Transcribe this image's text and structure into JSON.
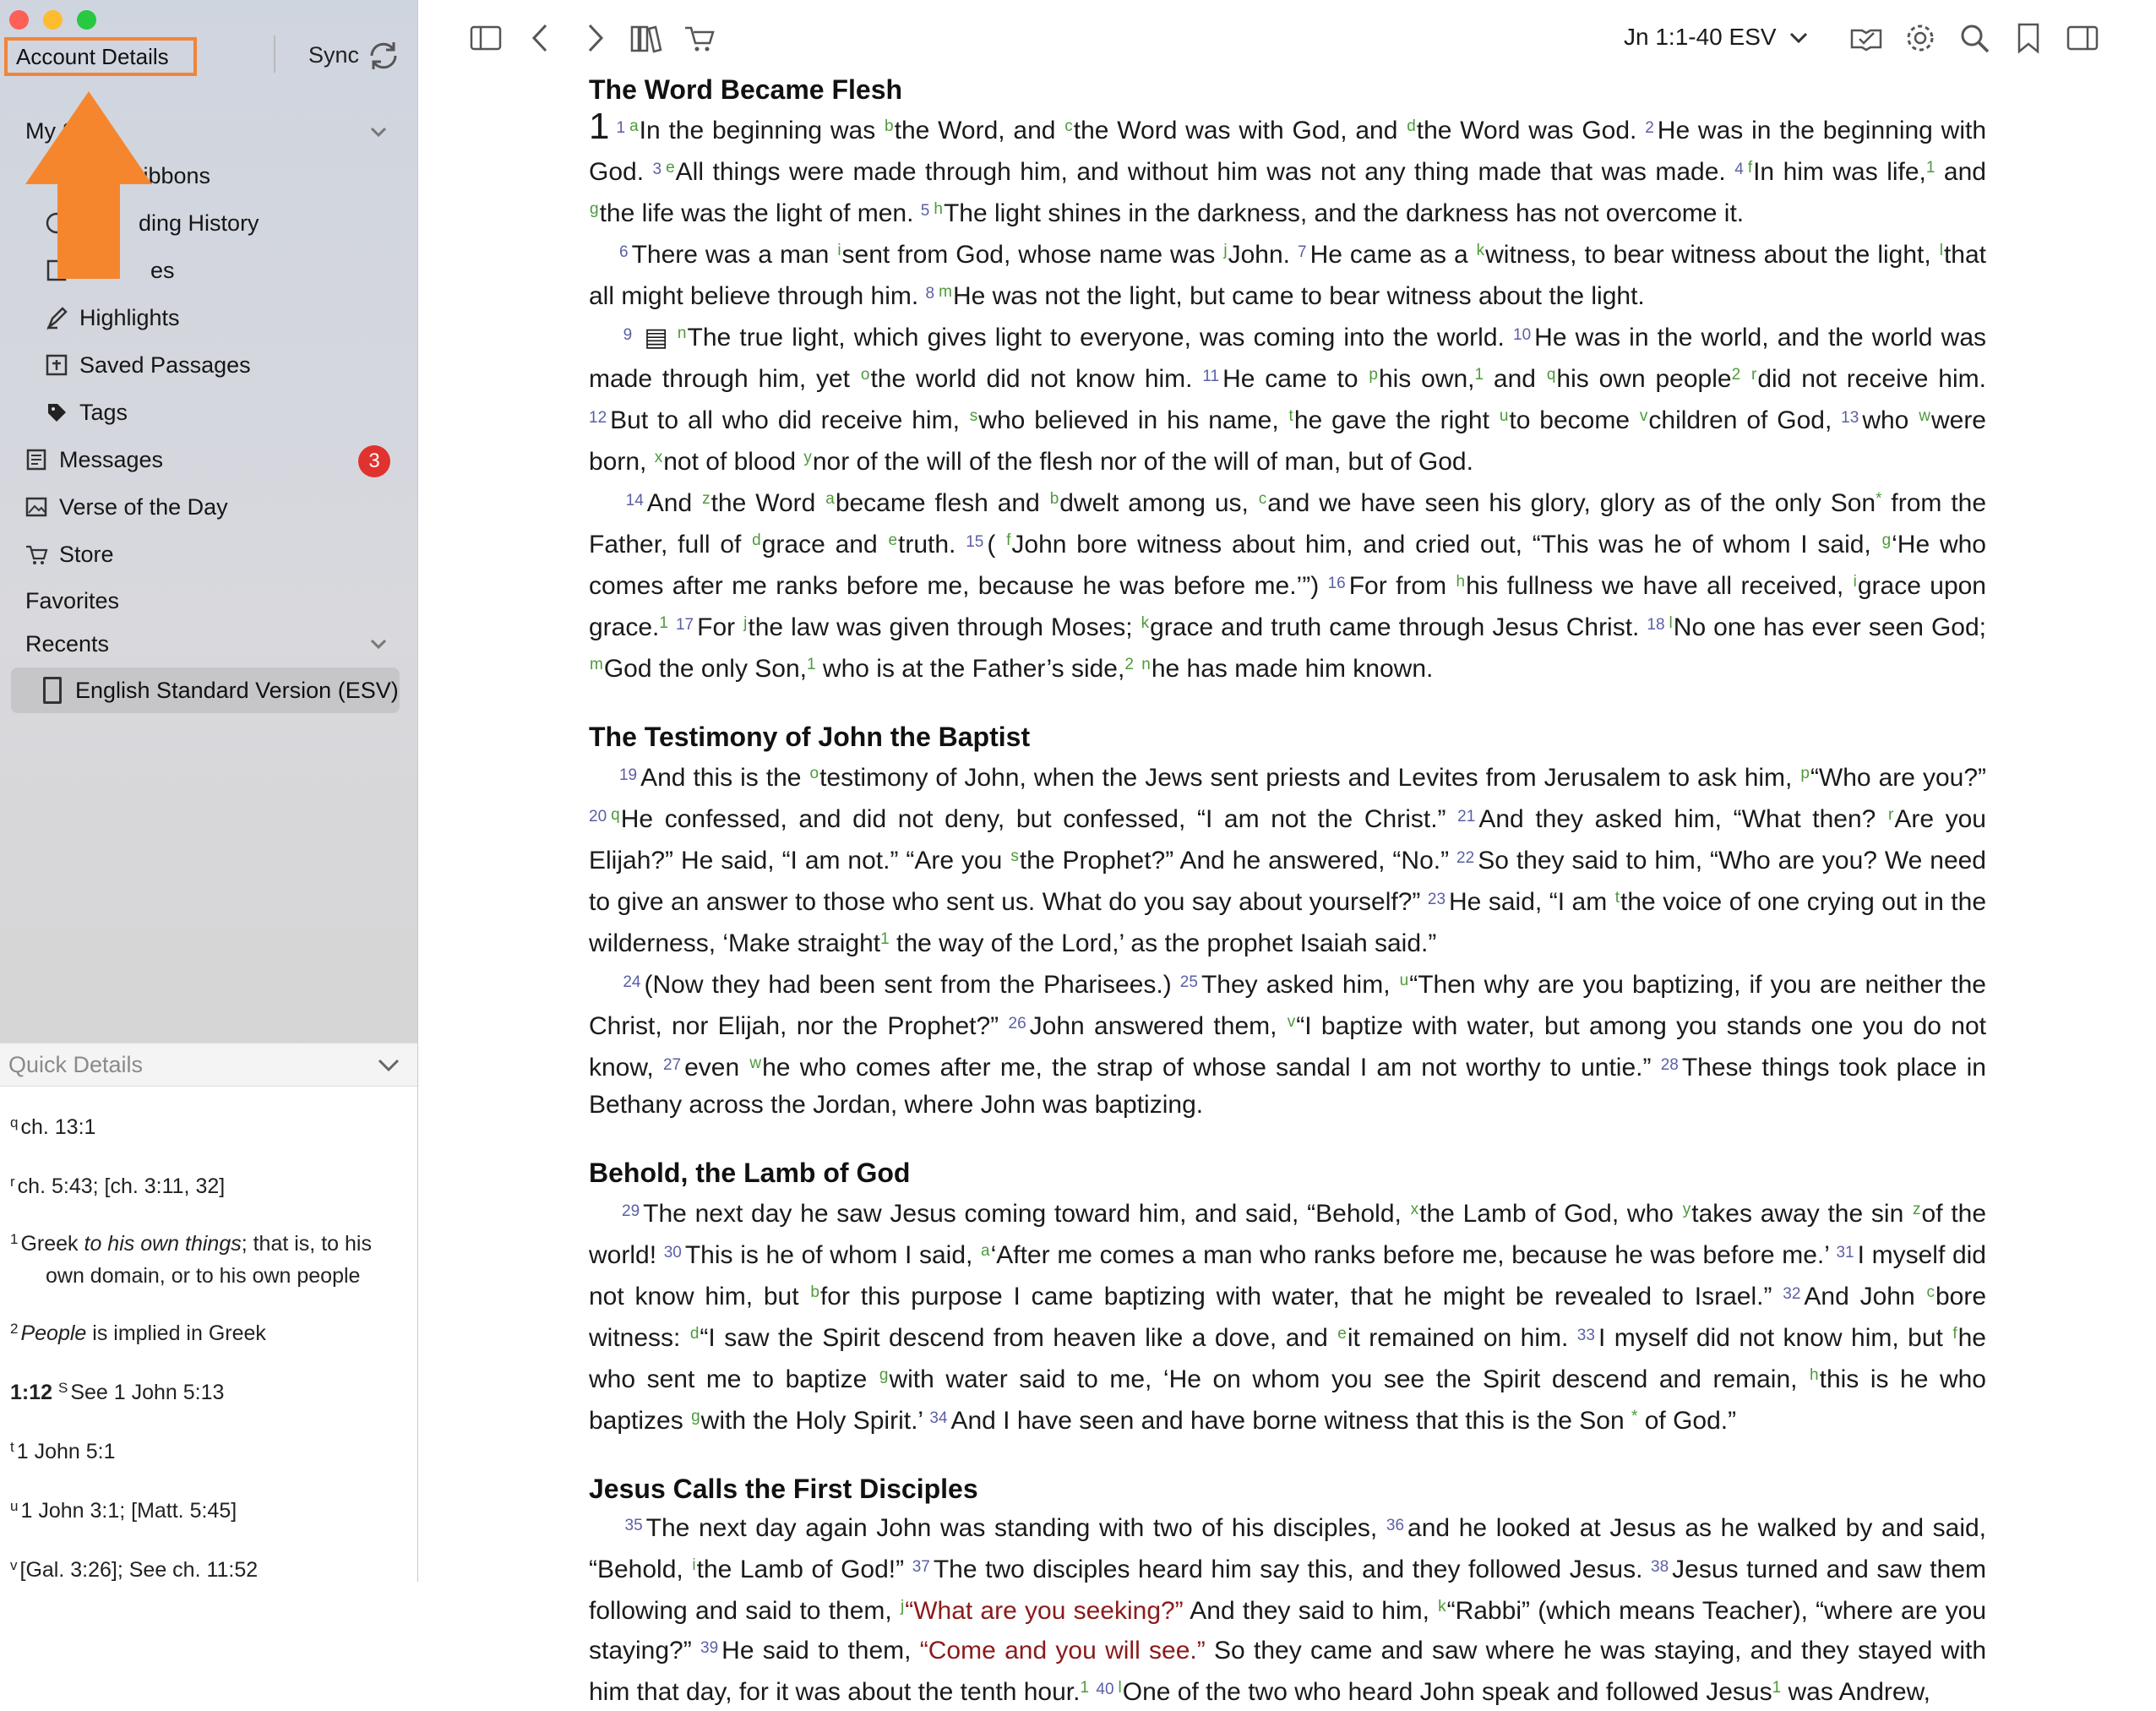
{
  "window": {
    "traffic_lights": [
      "#fe5f57",
      "#febc2e",
      "#28c840"
    ]
  },
  "sidebar": {
    "account_details": "Account Details",
    "sync_label": "Sync",
    "sections": {
      "my_stuff": "My S",
      "ribbons": "Ribbons",
      "reading_history": "ding History",
      "notes": "es",
      "highlights": "Highlights",
      "saved_passages": "Saved Passages",
      "tags": "Tags",
      "messages": "Messages",
      "messages_badge": "3",
      "verse_of_the_day": "Verse of the Day",
      "store": "Store",
      "favorites": "Favorites",
      "recents": "Recents",
      "recent_item": "English Standard Version (ESV)"
    }
  },
  "quick_details": {
    "title": "Quick Details",
    "notes": [
      {
        "mark": "q",
        "text": "ch. 13:1"
      },
      {
        "mark": "r",
        "text": "ch. 5:43; [ch. 3:11, 32]"
      },
      {
        "mark": "1",
        "pre": "Greek ",
        "em": "to his own things",
        "post": "; that is, to his",
        "line2": "own domain, or to his own people"
      },
      {
        "mark": "2",
        "em": "People",
        "post": " is implied in Greek"
      },
      {
        "ref": "1:12",
        "mark": "S",
        "text": "See 1 John 5:13"
      },
      {
        "mark": "t",
        "text": "1 John 5:1"
      },
      {
        "mark": "u",
        "text": "1 John 3:1; [Matt. 5:45]"
      },
      {
        "mark": "v",
        "text": "[Gal. 3:26]; See ch. 11:52"
      }
    ]
  },
  "toolbar": {
    "reference": "Jn 1:1-40  ESV",
    "left_icons": [
      "sidebar-toggle-icon",
      "back-icon",
      "forward-icon",
      "library-icon",
      "cart-icon"
    ],
    "right_icons": [
      "reading-plan-icon",
      "gear-icon",
      "search-icon",
      "bookmark-icon",
      "panel-icon"
    ]
  },
  "passage": {
    "h1": "The Word Became Flesh",
    "h2": "The Testimony of John the Baptist",
    "h3": "Behold, the Lamb of God",
    "h4": "Jesus Calls the First Disciples"
  }
}
